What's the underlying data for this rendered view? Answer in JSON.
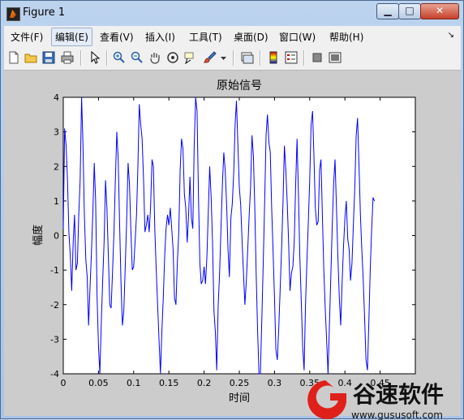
{
  "window": {
    "title": "Figure 1",
    "minimize": "▁",
    "maximize": "□",
    "close": "✕"
  },
  "menubar": {
    "items": [
      "文件(F)",
      "编辑(E)",
      "查看(V)",
      "插入(I)",
      "工具(T)",
      "桌面(D)",
      "窗口(W)",
      "帮助(H)"
    ],
    "overflow": "↘"
  },
  "toolbar": {
    "icons": [
      "new-file-icon",
      "open-folder-icon",
      "save-icon",
      "print-icon",
      "pointer-icon",
      "zoom-in-icon",
      "zoom-out-icon",
      "pan-hand-icon",
      "rotate-3d-icon",
      "data-cursor-icon",
      "brush-icon",
      "brush-dropdown-icon",
      "link-plot-icon",
      "colorbar-icon",
      "legend-icon",
      "hide-plot-tools-icon",
      "show-plot-tools-icon"
    ]
  },
  "watermark": {
    "brand": "谷速软件",
    "url": "www.gususoft.com",
    "color": "#e0201b"
  },
  "chart_data": {
    "type": "line",
    "title": "原始信号",
    "xlabel": "时间",
    "ylabel": "幅度",
    "xlim": [
      0,
      0.5
    ],
    "ylim": [
      -4,
      4
    ],
    "xticks": [
      "0",
      "0.05",
      "0.1",
      "0.15",
      "0.2",
      "0.25",
      "0.3",
      "0.35",
      "0.4",
      "0.45"
    ],
    "yticks": [
      "4",
      "3",
      "2",
      "1",
      "0",
      "-1",
      "-2",
      "-3",
      "-4"
    ],
    "line_color": "#0000ff",
    "grid": false,
    "series": [
      {
        "x_start": 0,
        "x_step": 0.002,
        "values": [
          0.2,
          3.1,
          2.6,
          1.6,
          0.1,
          -0.6,
          -1.6,
          -0.2,
          0.6,
          -1.0,
          -0.8,
          0.6,
          1.6,
          4.1,
          2.6,
          0.6,
          -0.7,
          -1.2,
          -2.6,
          -1.5,
          -0.5,
          0.7,
          2.1,
          1.0,
          -1.8,
          -3.2,
          -4.0,
          -2.5,
          -1.3,
          -0.2,
          1.6,
          0.8,
          -0.6,
          -2.0,
          -2.1,
          -1.0,
          0.1,
          1.6,
          3.0,
          2.2,
          0.4,
          -1.4,
          -2.6,
          -2.2,
          -0.9,
          0.4,
          2.1,
          1.5,
          0.2,
          -1.0,
          -0.9,
          -0.2,
          0.6,
          2.0,
          3.8,
          3.2,
          2.8,
          1.6,
          0.1,
          0.3,
          0.6,
          0.1,
          0.8,
          2.2,
          2.0,
          0.2,
          -1.0,
          -2.0,
          -3.0,
          -4.2,
          -2.8,
          -1.8,
          -0.6,
          0.2,
          0.6,
          0.3,
          0.8,
          0.2,
          -0.4,
          -1.8,
          -2.0,
          -0.8,
          0.1,
          1.9,
          2.8,
          2.5,
          1.2,
          0.8,
          -0.2,
          0.6,
          1.7,
          0.5,
          0.2,
          2.6,
          4.1,
          3.6,
          1.1,
          -0.8,
          -1.4,
          -1.3,
          -0.9,
          -1.4,
          -0.6,
          0.7,
          2.0,
          1.1,
          -0.2,
          -2.2,
          -2.8,
          -3.9,
          -2.0,
          -1.1,
          0.2,
          1.5,
          2.4,
          1.9,
          0.9,
          -0.4,
          -1.2,
          0.5,
          0.9,
          1.8,
          3.2,
          3.9,
          2.6,
          1.4,
          0.9,
          -0.2,
          -1.1,
          -2.0,
          -1.3,
          -0.4,
          0.6,
          1.4,
          2.9,
          2.3,
          0.8,
          -1.1,
          -2.8,
          -4.4,
          -4.1,
          -2.4,
          -0.8,
          0.9,
          2.9,
          3.5,
          2.7,
          2.4,
          0.8,
          -0.5,
          -1.8,
          -3.3,
          -3.6,
          -2.7,
          -1.6,
          -0.4,
          0.9,
          2.6,
          1.9,
          1.0,
          -0.2,
          -1.6,
          -1.1,
          -0.9,
          -0.2,
          1.4,
          2.8,
          1.2,
          -0.6,
          -1.9,
          -3.2,
          -3.9,
          -2.0,
          -0.8,
          0.4,
          1.6,
          3.2,
          3.6,
          2.3,
          0.8,
          0.3,
          0.4,
          1.9,
          2.2,
          0.6,
          -1.0,
          -2.1,
          -3.0,
          -4.0,
          -2.6,
          -1.2,
          0.3,
          1.5,
          2.2,
          0.8,
          -0.6,
          -1.8,
          -2.6,
          -1.4,
          -0.3,
          0.5,
          1.0,
          -0.1,
          -0.4,
          -1.3,
          -0.8,
          0.3,
          1.4,
          2.9,
          3.4,
          2.0,
          0.6,
          -0.4,
          -1.3,
          -2.4,
          -3.6,
          -3.9,
          -2.5,
          -1.0,
          0.2,
          1.1,
          1.0
        ]
      }
    ]
  }
}
